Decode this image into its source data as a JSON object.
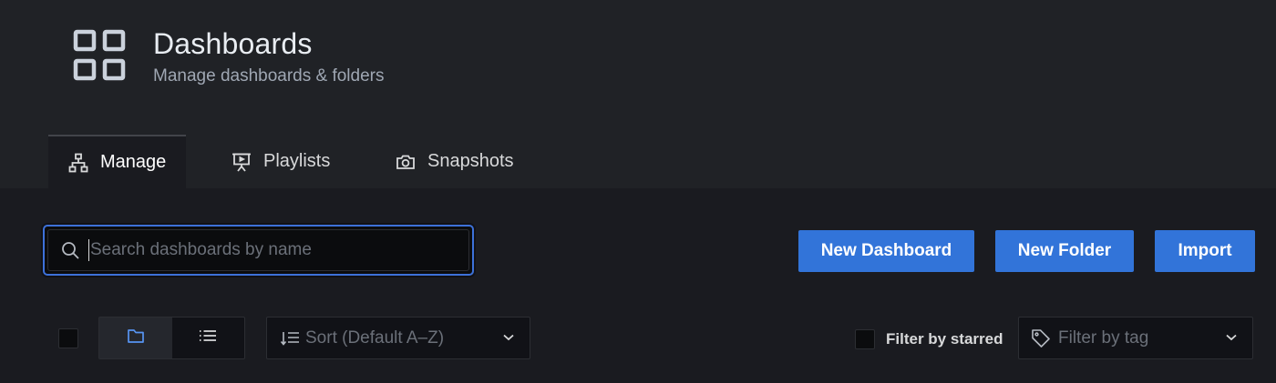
{
  "header": {
    "title": "Dashboards",
    "subtitle": "Manage dashboards & folders",
    "icon": "dashboard-grid-icon"
  },
  "tabs": [
    {
      "label": "Manage",
      "icon": "sitemap-icon",
      "active": true
    },
    {
      "label": "Playlists",
      "icon": "presentation-play-icon",
      "active": false
    },
    {
      "label": "Snapshots",
      "icon": "camera-icon",
      "active": false
    }
  ],
  "search": {
    "placeholder": "Search dashboards by name",
    "value": ""
  },
  "actions": {
    "new_dashboard": "New Dashboard",
    "new_folder": "New Folder",
    "import": "Import"
  },
  "toolbar": {
    "view_modes": [
      {
        "name": "folder-view",
        "icon": "folder-icon",
        "active": true
      },
      {
        "name": "list-view",
        "icon": "list-icon",
        "active": false
      }
    ],
    "sort_placeholder": "Sort (Default A–Z)",
    "starred_label": "Filter by starred",
    "tag_placeholder": "Filter by tag"
  },
  "colors": {
    "accent": "#3274d9",
    "focus_border": "#3d71d9",
    "active_view_icon": "#5794f2",
    "header_bg": "#202226",
    "page_bg": "#1a1b20"
  }
}
